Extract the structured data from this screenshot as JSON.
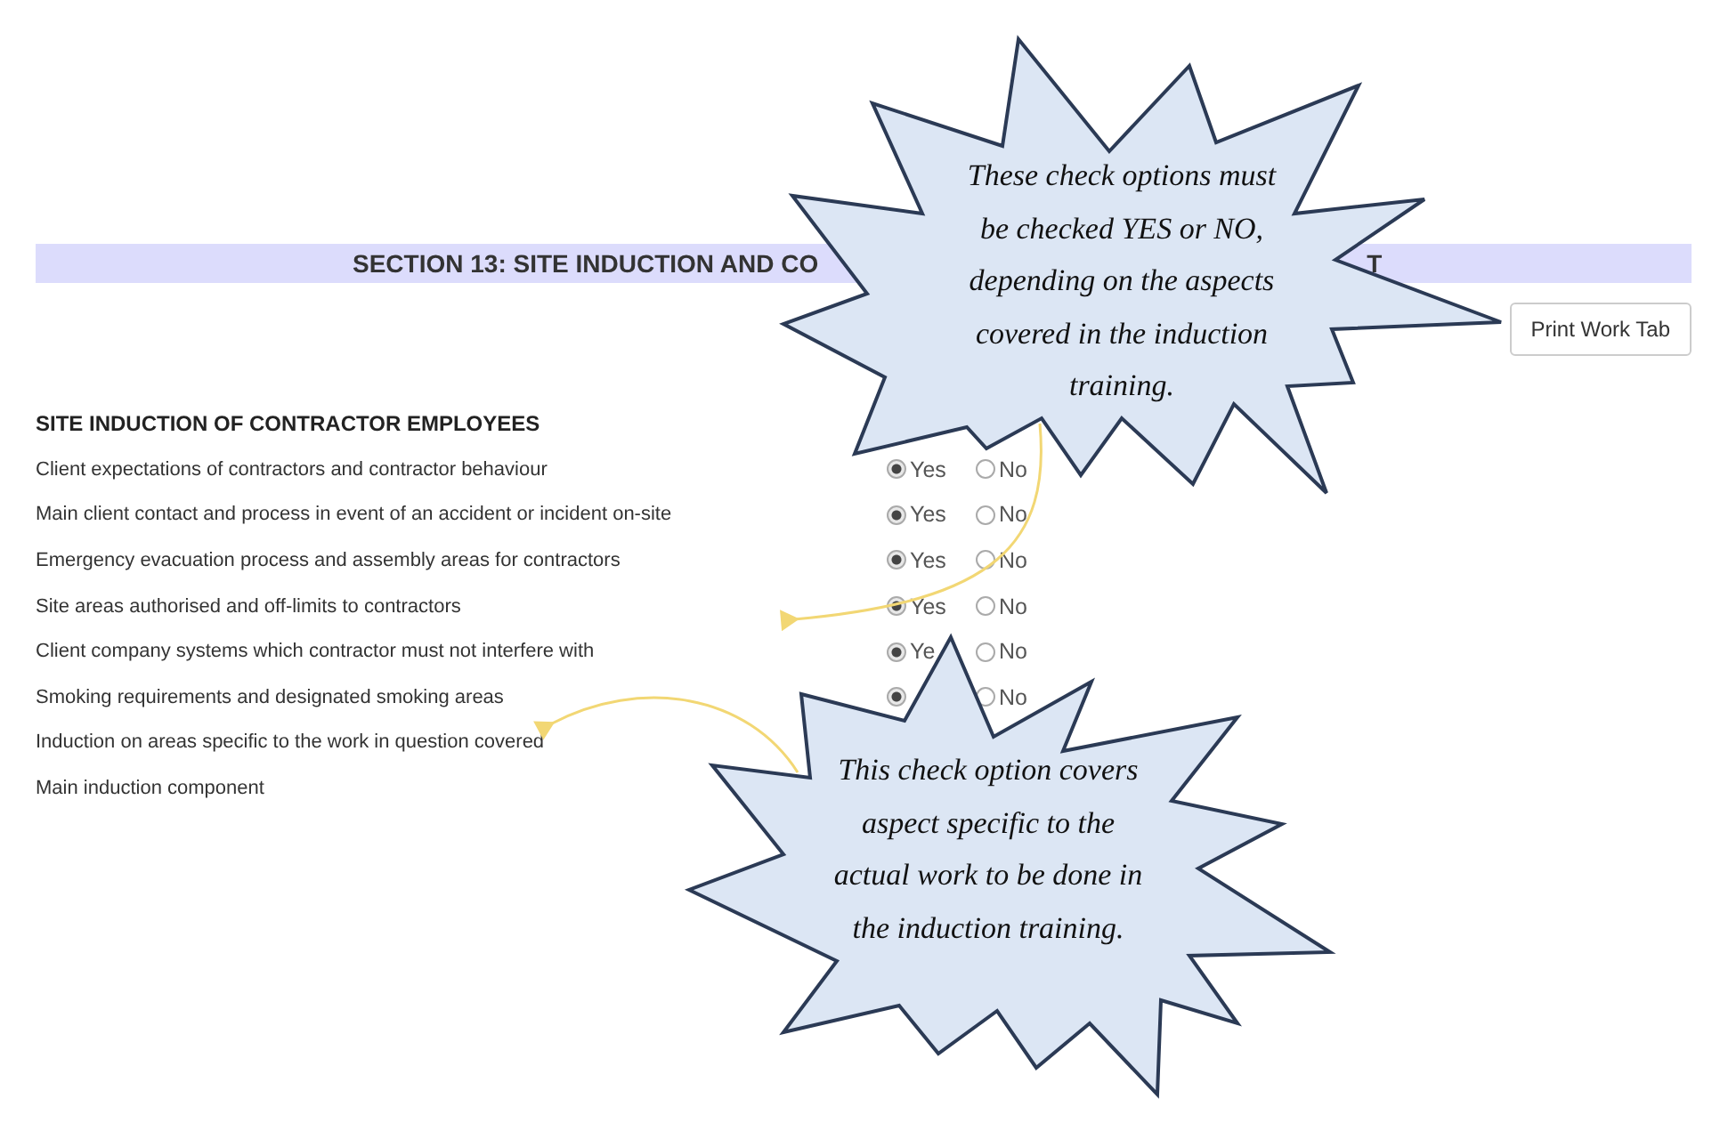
{
  "section_heading": {
    "left_part": "SECTION 13: SITE INDUCTION AND CO",
    "right_part": "T"
  },
  "print_button": "Print Work Tab",
  "subsection_title": "SITE INDUCTION OF CONTRACTOR EMPLOYEES",
  "rows": [
    {
      "label": "Client expectations of contractors and contractor behaviour",
      "options": [
        {
          "label": "Yes",
          "selected": true
        },
        {
          "label": "No",
          "selected": false
        }
      ]
    },
    {
      "label": "Main client contact and process in event of an accident or incident on-site",
      "options": [
        {
          "label": "Yes",
          "selected": true
        },
        {
          "label": "No",
          "selected": false
        }
      ]
    },
    {
      "label": "Emergency evacuation process and assembly areas for contractors",
      "options": [
        {
          "label": "Yes",
          "selected": true
        },
        {
          "label": "No",
          "selected": false
        }
      ]
    },
    {
      "label": "Site areas authorised and off-limits to contractors",
      "options": [
        {
          "label": "Yes",
          "selected": true
        },
        {
          "label": "No",
          "selected": false
        }
      ]
    },
    {
      "label": "Client company systems which contractor must not interfere with",
      "options": [
        {
          "label": "Ye",
          "selected": true
        },
        {
          "label": "No",
          "selected": false
        }
      ]
    },
    {
      "label": "Smoking requirements and designated smoking areas",
      "options": [
        {
          "selected": true
        },
        {
          "label": "No",
          "selected": false
        }
      ]
    },
    {
      "label": "Induction on areas specific to the work in question covered",
      "options": []
    },
    {
      "label": "Main induction component",
      "options": []
    }
  ],
  "callouts": [
    {
      "text": "These check options must be checked YES or NO, depending on the aspects covered in the induction training."
    },
    {
      "text": "This check option covers aspect specific to the actual work to be done in the induction training."
    }
  ]
}
